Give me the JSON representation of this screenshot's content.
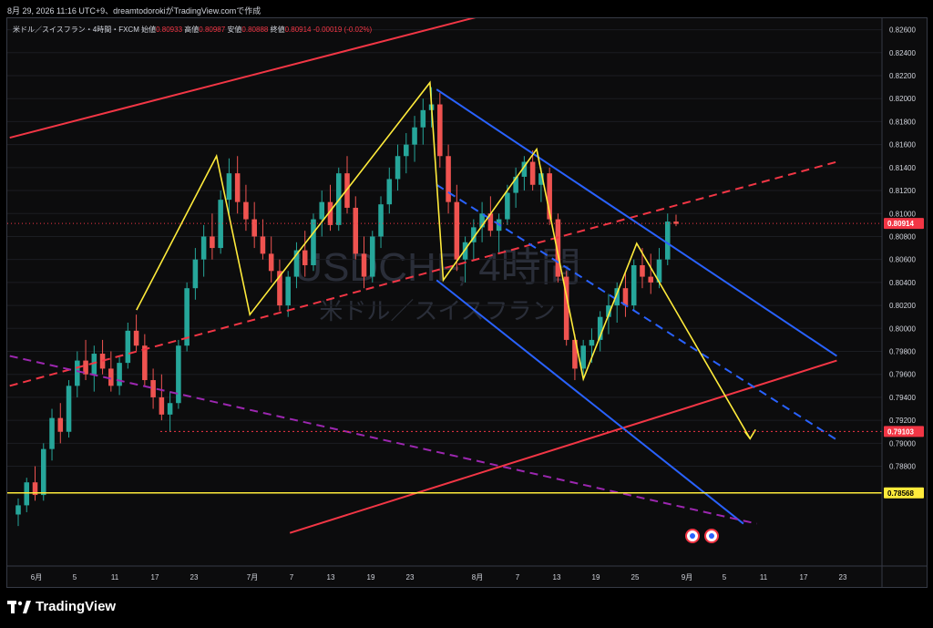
{
  "header": {
    "caption": "8月 29, 2026 11:16 UTC+9、dreamtodorokiがTradingView.comで作成"
  },
  "legend": {
    "symbol": "米ドル／スイスフラン・4時間・FXCM",
    "open_label": "始値",
    "open": "0.80933",
    "high_label": "高値",
    "high": "0.80987",
    "low_label": "安値",
    "low": "0.80888",
    "close_label": "終値",
    "close": "0.80914",
    "change": "-0.00019 (-0.02%)"
  },
  "watermark": {
    "main": "USDCHF, 4時間",
    "sub": "米ドル／スイスフラン"
  },
  "brand": {
    "name": "TradingView"
  },
  "colors": {
    "background": "#0c0c0d",
    "up": "#26a69a",
    "down": "#ef5350",
    "red_line": "#f23645",
    "blue_line": "#2962ff",
    "zigzag": "#ffeb3b",
    "magenta_dash": "#9c27b0",
    "yellow_level": "#ffeb3b"
  },
  "chart_data": {
    "type": "candlestick",
    "symbol": "USDCHF",
    "timeframe": "4H",
    "price_axis": {
      "ticks": [
        "0.82600",
        "0.82400",
        "0.82200",
        "0.82000",
        "0.81800",
        "0.81600",
        "0.81400",
        "0.81200",
        "0.81000",
        "0.80800",
        "0.80600",
        "0.80400",
        "0.80200",
        "0.80000",
        "0.79800",
        "0.79600",
        "0.79400",
        "0.79200",
        "0.79000",
        "0.78800"
      ],
      "range": [
        0.7813,
        0.827
      ]
    },
    "time_axis": {
      "ticks": [
        "6月",
        "5",
        "11",
        "17",
        "23",
        "7月",
        "7",
        "13",
        "19",
        "23",
        "8月",
        "7",
        "13",
        "19",
        "25",
        "9月",
        "5",
        "11",
        "17",
        "23"
      ]
    },
    "price_labels": [
      {
        "value": "0.80914",
        "kind": "last_price",
        "color": "#f23645"
      },
      {
        "value": "0.79103",
        "kind": "level",
        "color": "#f23645"
      },
      {
        "value": "0.78568",
        "kind": "horizontal_line",
        "color": "#ffeb3b"
      }
    ],
    "drawings": {
      "red_channel_upper": [
        [
          "2026-05-28",
          0.8166
        ],
        [
          "2026-08-20",
          0.8292
        ]
      ],
      "red_channel_lower": [
        [
          "2026-07-09",
          0.7822
        ],
        [
          "2026-09-29",
          0.7972
        ]
      ],
      "red_midline_dashed": [
        [
          "2026-05-28",
          0.795
        ],
        [
          "2026-09-29",
          0.8145
        ]
      ],
      "blue_channel_upper": [
        [
          "2026-07-31",
          0.8208
        ],
        [
          "2026-09-29",
          0.7976
        ]
      ],
      "blue_channel_lower": [
        [
          "2026-07-31",
          0.8042
        ],
        [
          "2026-09-15",
          0.783
        ]
      ],
      "blue_midline_dashed": [
        [
          "2026-07-31",
          0.8125
        ],
        [
          "2026-09-29",
          0.7903
        ]
      ],
      "magenta_dashed": [
        [
          "2026-05-28",
          0.7976
        ],
        [
          "2026-09-17",
          0.783
        ]
      ],
      "zigzag_projection": [
        [
          "2026-06-16",
          0.8016
        ],
        [
          "2026-06-28",
          0.815
        ],
        [
          "2026-07-03",
          0.8012
        ],
        [
          "2026-07-30",
          0.8214
        ],
        [
          "2026-08-01",
          0.8042
        ],
        [
          "2026-08-15",
          0.8156
        ],
        [
          "2026-08-22",
          0.7956
        ],
        [
          "2026-08-30",
          0.8074
        ],
        [
          "2026-09-16",
          0.7904
        ]
      ],
      "level_dotted_0_79103": 0.79103,
      "level_line_0_78568": 0.78568
    },
    "candles_note": "4H USDCHF price history from early June to end of August 2026",
    "candles": [
      [
        0.7838,
        0.7852,
        0.7828,
        0.7846
      ],
      [
        0.7846,
        0.787,
        0.784,
        0.7866
      ],
      [
        0.7866,
        0.788,
        0.785,
        0.7855
      ],
      [
        0.7855,
        0.79,
        0.785,
        0.7895
      ],
      [
        0.7895,
        0.793,
        0.7885,
        0.7922
      ],
      [
        0.7922,
        0.7935,
        0.79,
        0.791
      ],
      [
        0.791,
        0.7955,
        0.7905,
        0.795
      ],
      [
        0.795,
        0.798,
        0.794,
        0.7972
      ],
      [
        0.7972,
        0.799,
        0.7955,
        0.796
      ],
      [
        0.796,
        0.7985,
        0.7945,
        0.7978
      ],
      [
        0.7978,
        0.799,
        0.796,
        0.7965
      ],
      [
        0.7965,
        0.798,
        0.7945,
        0.795
      ],
      [
        0.795,
        0.7975,
        0.7942,
        0.797
      ],
      [
        0.797,
        0.8005,
        0.7965,
        0.7998
      ],
      [
        0.7998,
        0.8012,
        0.798,
        0.7985
      ],
      [
        0.7985,
        0.7995,
        0.795,
        0.7955
      ],
      [
        0.7955,
        0.7965,
        0.793,
        0.794
      ],
      [
        0.794,
        0.796,
        0.792,
        0.7925
      ],
      [
        0.7925,
        0.7945,
        0.791,
        0.7935
      ],
      [
        0.7935,
        0.799,
        0.793,
        0.7985
      ],
      [
        0.7985,
        0.804,
        0.798,
        0.8035
      ],
      [
        0.8035,
        0.807,
        0.8025,
        0.806
      ],
      [
        0.806,
        0.809,
        0.8045,
        0.808
      ],
      [
        0.808,
        0.81,
        0.806,
        0.807
      ],
      [
        0.807,
        0.812,
        0.8065,
        0.8112
      ],
      [
        0.8112,
        0.8148,
        0.81,
        0.8135
      ],
      [
        0.8135,
        0.815,
        0.81,
        0.811
      ],
      [
        0.811,
        0.8125,
        0.8085,
        0.8095
      ],
      [
        0.8095,
        0.811,
        0.807,
        0.808
      ],
      [
        0.808,
        0.8095,
        0.806,
        0.8065
      ],
      [
        0.8065,
        0.808,
        0.804,
        0.805
      ],
      [
        0.805,
        0.806,
        0.8015,
        0.802
      ],
      [
        0.802,
        0.805,
        0.801,
        0.8045
      ],
      [
        0.8045,
        0.8075,
        0.8035,
        0.8068
      ],
      [
        0.8068,
        0.8085,
        0.8045,
        0.8055
      ],
      [
        0.8055,
        0.81,
        0.805,
        0.8095
      ],
      [
        0.8095,
        0.812,
        0.808,
        0.811
      ],
      [
        0.811,
        0.8125,
        0.8085,
        0.809
      ],
      [
        0.809,
        0.814,
        0.8085,
        0.8135
      ],
      [
        0.8135,
        0.815,
        0.81,
        0.8105
      ],
      [
        0.8105,
        0.8115,
        0.806,
        0.8065
      ],
      [
        0.8065,
        0.808,
        0.8035,
        0.8045
      ],
      [
        0.8045,
        0.8085,
        0.804,
        0.808
      ],
      [
        0.808,
        0.8115,
        0.807,
        0.8108
      ],
      [
        0.8108,
        0.814,
        0.81,
        0.813
      ],
      [
        0.813,
        0.816,
        0.812,
        0.815
      ],
      [
        0.815,
        0.817,
        0.8135,
        0.816
      ],
      [
        0.816,
        0.8185,
        0.8145,
        0.8175
      ],
      [
        0.8175,
        0.82,
        0.816,
        0.819
      ],
      [
        0.819,
        0.821,
        0.8175,
        0.8195
      ],
      [
        0.8195,
        0.8205,
        0.814,
        0.815
      ],
      [
        0.815,
        0.816,
        0.81,
        0.811
      ],
      [
        0.811,
        0.8125,
        0.805,
        0.806
      ],
      [
        0.806,
        0.808,
        0.804,
        0.8075
      ],
      [
        0.8075,
        0.8095,
        0.806,
        0.8088
      ],
      [
        0.8088,
        0.811,
        0.8075,
        0.81
      ],
      [
        0.81,
        0.8115,
        0.808,
        0.8085
      ],
      [
        0.8085,
        0.81,
        0.8065,
        0.8095
      ],
      [
        0.8095,
        0.8125,
        0.809,
        0.8118
      ],
      [
        0.8118,
        0.814,
        0.8105,
        0.8132
      ],
      [
        0.8132,
        0.815,
        0.812,
        0.8145
      ],
      [
        0.8145,
        0.8155,
        0.812,
        0.8125
      ],
      [
        0.8125,
        0.814,
        0.811,
        0.8135
      ],
      [
        0.8135,
        0.814,
        0.809,
        0.8095
      ],
      [
        0.8095,
        0.81,
        0.804,
        0.8045
      ],
      [
        0.8045,
        0.805,
        0.7985,
        0.799
      ],
      [
        0.799,
        0.7995,
        0.7955,
        0.7965
      ],
      [
        0.7965,
        0.799,
        0.7955,
        0.7985
      ],
      [
        0.7985,
        0.8,
        0.797,
        0.799
      ],
      [
        0.799,
        0.8015,
        0.798,
        0.801
      ],
      [
        0.801,
        0.803,
        0.7995,
        0.802
      ],
      [
        0.802,
        0.804,
        0.8005,
        0.8035
      ],
      [
        0.8035,
        0.805,
        0.801,
        0.802
      ],
      [
        0.802,
        0.806,
        0.8015,
        0.8055
      ],
      [
        0.8055,
        0.807,
        0.8035,
        0.8045
      ],
      [
        0.8045,
        0.8065,
        0.803,
        0.804
      ],
      [
        0.804,
        0.807,
        0.8035,
        0.806
      ],
      [
        0.806,
        0.81,
        0.8055,
        0.8093
      ],
      [
        0.8093,
        0.8099,
        0.8089,
        0.8091
      ]
    ]
  }
}
